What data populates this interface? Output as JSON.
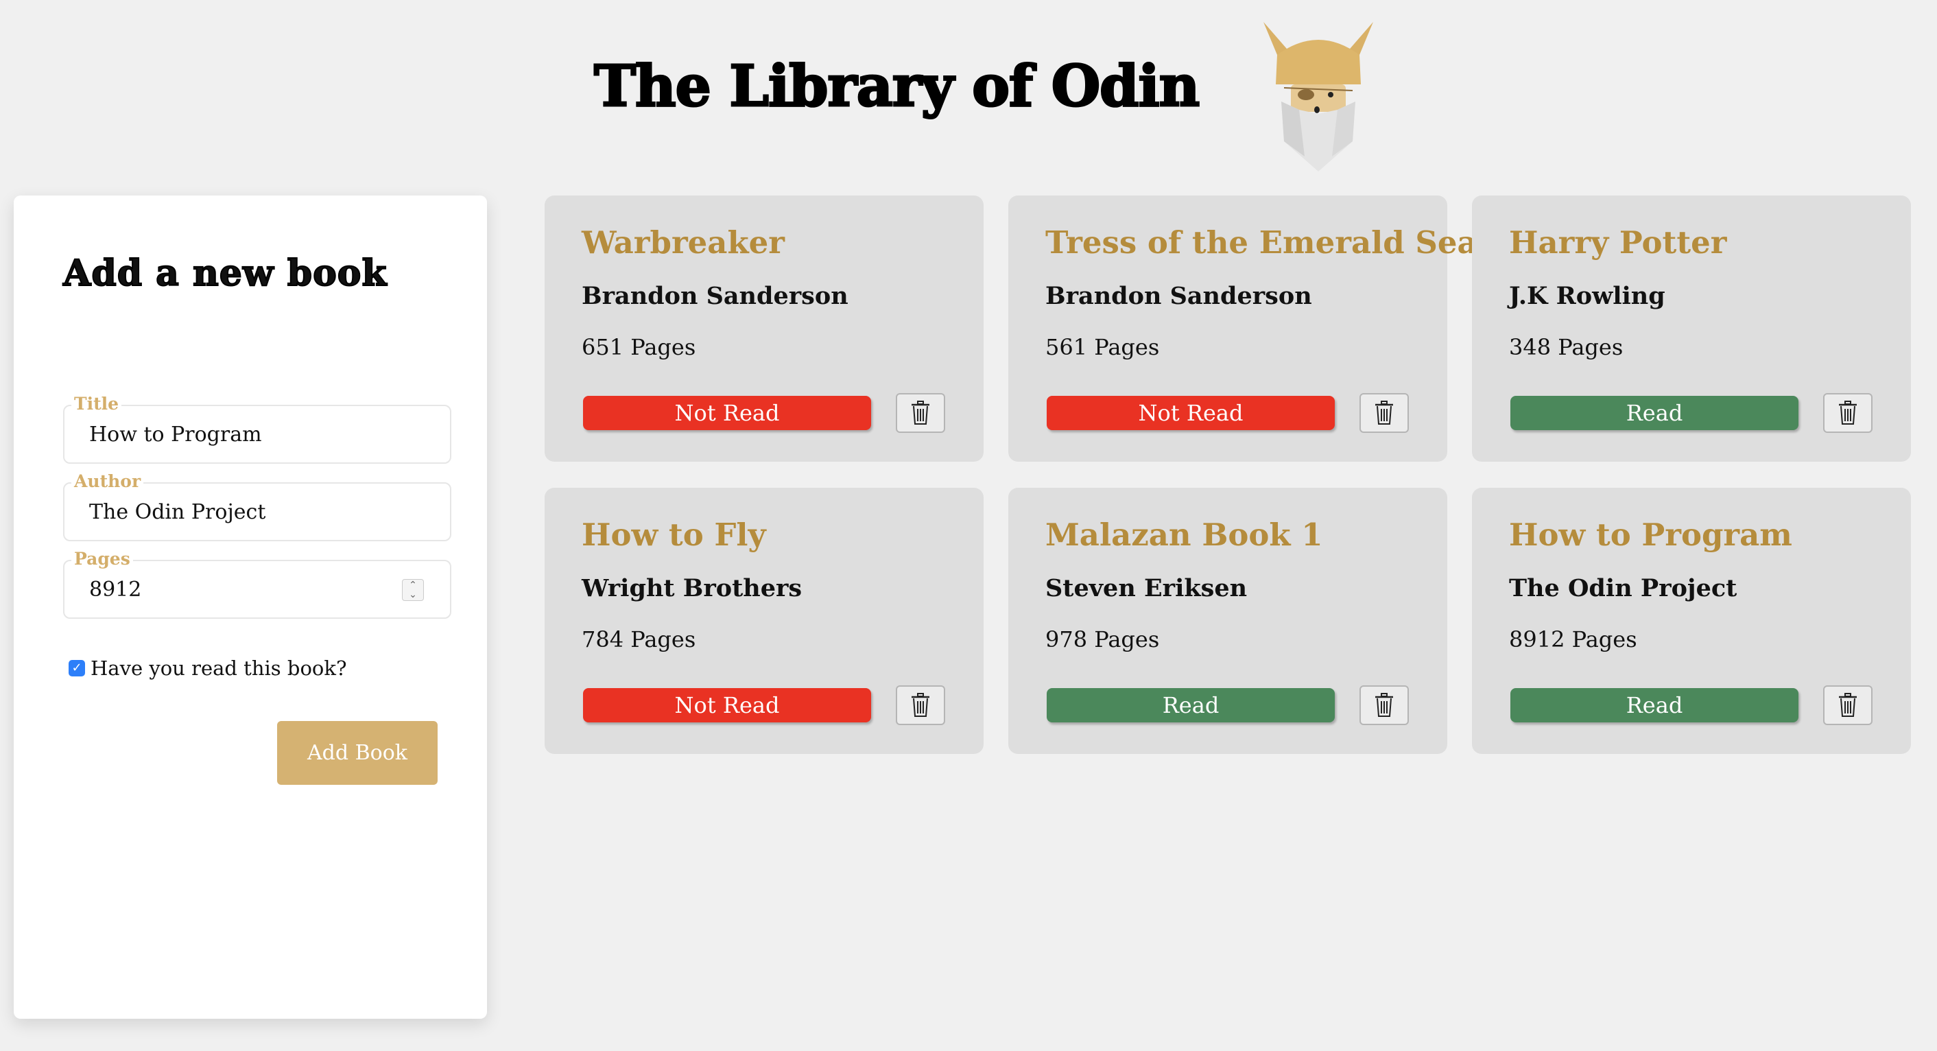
{
  "header": {
    "title": "The Library of Odin",
    "logo_icon": "odin-viking-icon"
  },
  "form": {
    "heading": "Add a new book",
    "fields": {
      "title": {
        "label": "Title",
        "value": "How to Program"
      },
      "author": {
        "label": "Author",
        "value": "The Odin Project"
      },
      "pages": {
        "label": "Pages",
        "value": "8912"
      }
    },
    "read_checkbox": {
      "label": "Have you read this book?",
      "checked": true
    },
    "submit_label": "Add Book"
  },
  "colors": {
    "accent_gold": "#d5b272",
    "title_gold": "#b58c3c",
    "not_read_red": "#e93223",
    "read_green": "#4b885b",
    "card_bg": "#dedede",
    "page_bg": "#f0f0f0"
  },
  "books": [
    {
      "title": "Warbreaker",
      "author": "Brandon Sanderson",
      "pages": "651 Pages",
      "status": "Not Read",
      "delete_icon": "trash-icon"
    },
    {
      "title": "Tress of the Emerald Sea",
      "author": "Brandon Sanderson",
      "pages": "561 Pages",
      "status": "Not Read",
      "delete_icon": "trash-icon"
    },
    {
      "title": "Harry Potter",
      "author": "J.K Rowling",
      "pages": "348 Pages",
      "status": "Read",
      "delete_icon": "trash-icon"
    },
    {
      "title": "How to Fly",
      "author": "Wright Brothers",
      "pages": "784 Pages",
      "status": "Not Read",
      "delete_icon": "trash-icon"
    },
    {
      "title": "Malazan Book 1",
      "author": "Steven Eriksen",
      "pages": "978 Pages",
      "status": "Read",
      "delete_icon": "trash-icon"
    },
    {
      "title": "How to Program",
      "author": "The Odin Project",
      "pages": "8912 Pages",
      "status": "Read",
      "delete_icon": "trash-icon"
    }
  ]
}
